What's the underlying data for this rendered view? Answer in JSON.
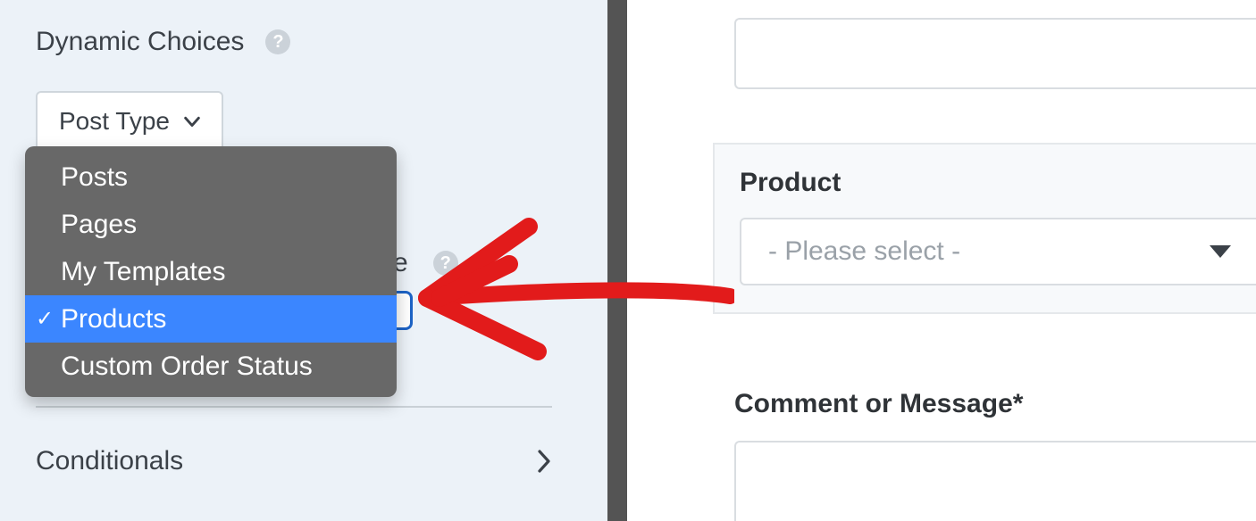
{
  "left": {
    "dynamic_choices_label": "Dynamic Choices",
    "post_type_label": "Post Type",
    "peek_text": "e",
    "conditionals_label": "Conditionals"
  },
  "dropdown": {
    "items": [
      {
        "label": "Posts"
      },
      {
        "label": "Pages"
      },
      {
        "label": "My Templates"
      },
      {
        "label": "Products"
      },
      {
        "label": "Custom Order Status"
      }
    ],
    "selected_index": 3
  },
  "form": {
    "product_label": "Product",
    "product_placeholder": "- Please select -",
    "comment_label": "Comment or Message",
    "required_mark": "*"
  },
  "colors": {
    "panel_bg": "#ecf2f8",
    "dropdown_bg": "#686868",
    "dropdown_sel": "#3b86ff",
    "accent_blue": "#1d63c6",
    "annotation_red": "#e21b1b"
  }
}
